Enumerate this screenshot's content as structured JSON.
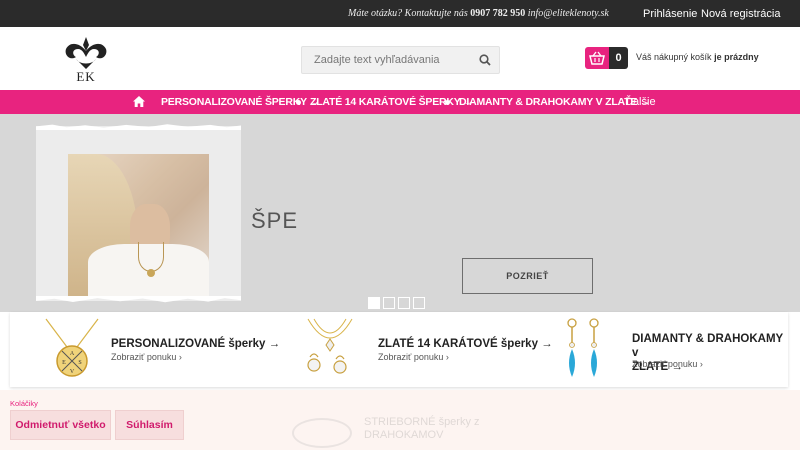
{
  "topbar": {
    "contact_label": "Máte otázku? Kontaktujte nás",
    "phone": "0907 782 950",
    "email": "info@eliteklenoty.sk",
    "login": "Prihlásenie",
    "register": "Nová registrácia"
  },
  "header": {
    "logo_text": "EK",
    "search_placeholder": "Zadajte text vyhľadávania",
    "cart_count": "0",
    "cart_text": "Váš nákupný košík",
    "cart_status": "je prázdny"
  },
  "nav": {
    "items": [
      "PERSONALIZOVANÉ ŠPERKY →",
      "ZLATÉ 14 KARÁTOVÉ ŠPERKY →",
      "DIAMANTY & DRAHOKAMY V ZLATE →"
    ],
    "more": "Ďalšie"
  },
  "hero": {
    "title": "ŠPE",
    "button": "POZRIEŤ",
    "slides": 4,
    "active_slide": 1
  },
  "cards": [
    {
      "title": "PERSONALIZOVANÉ šperky →",
      "link": "Zobraziť ponuku ›"
    },
    {
      "title": "ZLATÉ 14 KARÁTOVÉ šperky →",
      "link": "Zobraziť ponuku ›"
    },
    {
      "title_line1": "DIAMANTY & DRAHOKAMY v",
      "title_line2": "ZLATE →",
      "link": "Zobraziť ponuku ›"
    }
  ],
  "cookies": {
    "label": "Koláčiky",
    "reject": "Odmietnuť všetko",
    "accept": "Súhlasím"
  },
  "ghost": {
    "line1": "STRIEBORNÉ šperky z",
    "line2": "DRAHOKAMOV"
  },
  "colors": {
    "accent": "#e8237f",
    "topbar": "#2b2b2b",
    "hero_bg": "#d7d7d7"
  }
}
